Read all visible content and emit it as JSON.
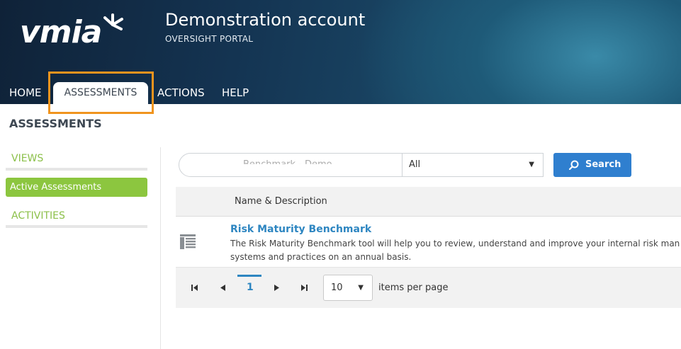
{
  "header": {
    "logo_text": "vmia",
    "account_title": "Demonstration account",
    "account_subtitle": "OVERSIGHT PORTAL"
  },
  "nav": {
    "home": "HOME",
    "assessments": "ASSESSMENTS",
    "actions": "ACTIONS",
    "help": "HELP"
  },
  "page": {
    "title": "ASSESSMENTS"
  },
  "sidebar": {
    "views_label": "VIEWS",
    "active_item": "Active Assessments",
    "activities_label": "ACTIVITIES"
  },
  "search": {
    "input_value": "Benchmark - Demo",
    "filter_value": "All",
    "button_label": "Search"
  },
  "grid": {
    "column_header": "Name & Description",
    "rows": [
      {
        "title": "Risk Maturity Benchmark",
        "description_line1": "The Risk Maturity Benchmark tool will help you to review, understand and improve your internal risk man",
        "description_line2": "systems and practices on an annual basis."
      }
    ]
  },
  "pager": {
    "current_page": "1",
    "page_size": "10",
    "page_size_label": "items per page"
  },
  "colors": {
    "accent_green": "#8cc63f",
    "link_blue": "#2e86c1",
    "button_blue": "#2f7fcf",
    "highlight_orange": "#f0941e"
  }
}
